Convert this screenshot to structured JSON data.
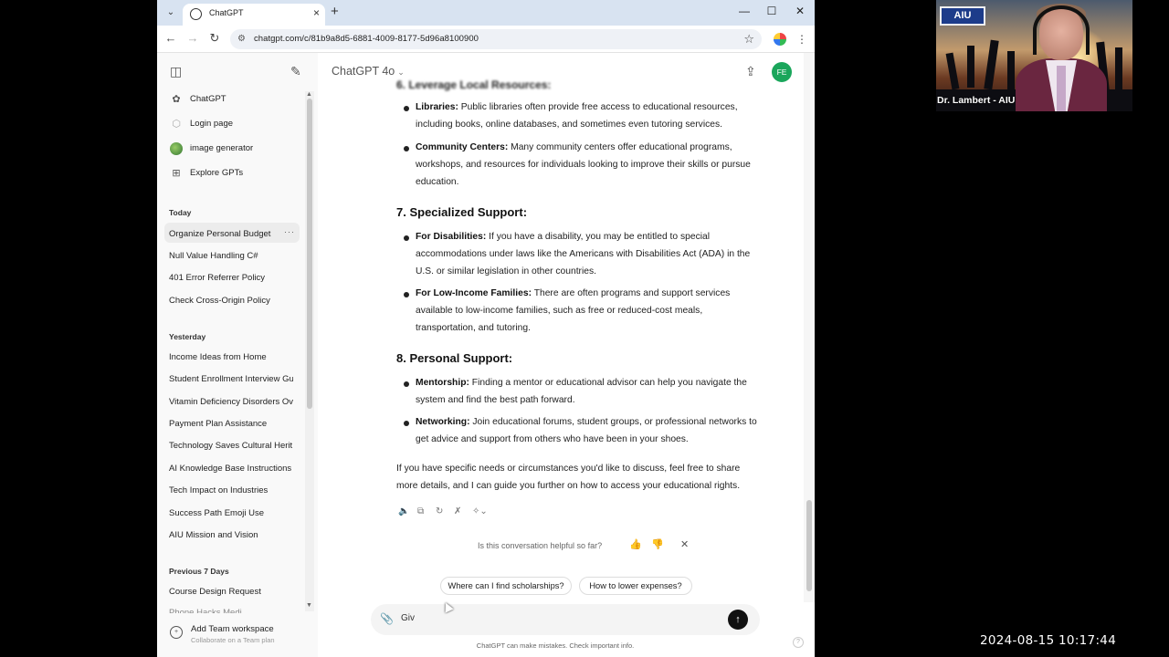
{
  "browser": {
    "tab_title": "ChatGPT",
    "url": "chatgpt.com/c/81b9a8d5-6881-4009-8177-5d96a8100900"
  },
  "sidebar": {
    "nav": [
      {
        "label": "ChatGPT",
        "icon": "openai-icon"
      },
      {
        "label": "Login page",
        "icon": "gpt-icon"
      },
      {
        "label": "image generator",
        "icon": "generator-avatar-icon"
      },
      {
        "label": "Explore GPTs",
        "icon": "grid-icon"
      }
    ],
    "sections": [
      {
        "heading": "Today",
        "items": [
          "Organize Personal Budget",
          "Null Value Handling C#",
          "401 Error Referrer Policy",
          "Check Cross-Origin Policy"
        ]
      },
      {
        "heading": "Yesterday",
        "items": [
          "Income Ideas from Home",
          "Student Enrollment Interview Gu",
          "Vitamin Deficiency Disorders Ov",
          "Payment Plan Assistance",
          "Technology Saves Cultural Herit",
          "AI Knowledge Base Instructions",
          "Tech Impact on Industries",
          "Success Path Emoji Use",
          "AIU Mission and Vision"
        ]
      },
      {
        "heading": "Previous 7 Days",
        "items": [
          "Course Design Request",
          "Phone Hacks Medi"
        ]
      }
    ],
    "active_item_dots": "···",
    "team": {
      "title": "Add Team workspace",
      "subtitle": "Collaborate on a Team plan"
    }
  },
  "main": {
    "model": "ChatGPT 4o",
    "avatar_initials": "FE",
    "cut_heading": "6. Leverage Local Resources:",
    "bullets_top": [
      {
        "bold": "Libraries:",
        "text": " Public libraries often provide free access to educational resources, including books, online databases, and sometimes even tutoring services."
      },
      {
        "bold": "Community Centers:",
        "text": " Many community centers offer educational programs, workshops, and resources for individuals looking to improve their skills or pursue education."
      }
    ],
    "h7": "7. Specialized Support:",
    "bullets_7": [
      {
        "bold": "For Disabilities:",
        "text": " If you have a disability, you may be entitled to special accommodations under laws like the Americans with Disabilities Act (ADA) in the U.S. or similar legislation in other countries."
      },
      {
        "bold": "For Low-Income Families:",
        "text": " There are often programs and support services available to low-income families, such as free or reduced-cost meals, transportation, and tutoring."
      }
    ],
    "h8": "8. Personal Support:",
    "bullets_8": [
      {
        "bold": "Mentorship:",
        "text": " Finding a mentor or educational advisor can help you navigate the system and find the best path forward."
      },
      {
        "bold": "Networking:",
        "text": " Join educational forums, student groups, or professional networks to get advice and support from others who have been in your shoes."
      }
    ],
    "closing": "If you have specific needs or circumstances you'd like to discuss, feel free to share more details, and I can guide you further on how to access your educational rights.",
    "feedback_question": "Is this conversation helpful so far?",
    "suggestions": [
      "Where can I find scholarships?",
      "How to lower expenses?"
    ],
    "composer_value": "Giv",
    "disclaimer": "ChatGPT can make mistakes. Check important info.",
    "help": "?"
  },
  "webcam": {
    "logo": "AIU",
    "name": "Dr. Lambert - AIU"
  },
  "timestamp": "2024-08-15  10:17:44"
}
